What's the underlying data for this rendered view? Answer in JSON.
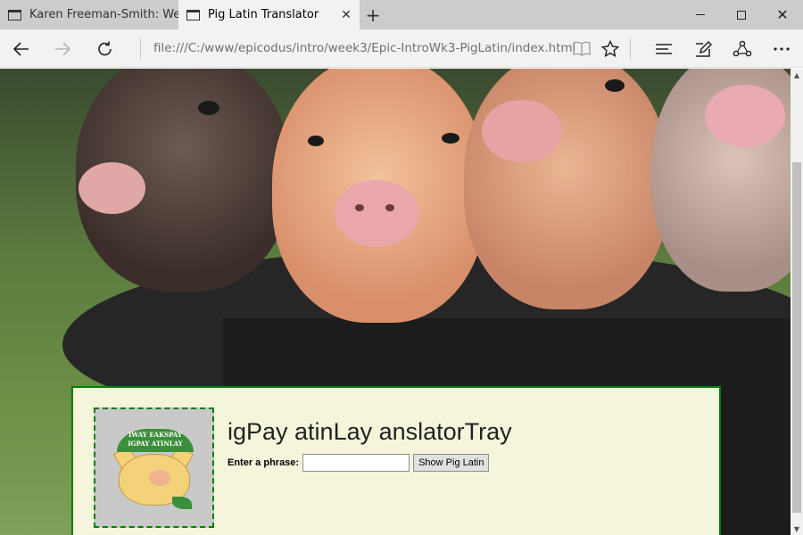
{
  "browser": {
    "tabs": [
      {
        "title": "Karen Freeman-Smith: Web",
        "active": false
      },
      {
        "title": "Pig Latin Translator",
        "active": true
      }
    ],
    "new_tab_glyph": "+",
    "url": "file:///C:/www/epicodus/intro/week3/Epic-IntroWk3-PigLatin/index.html",
    "icons": {
      "back": "back-arrow-icon",
      "forward": "forward-arrow-icon",
      "refresh": "refresh-icon",
      "reading_view": "reading-view-icon",
      "favorite": "star-icon",
      "hub": "hub-icon",
      "web_note": "web-note-icon",
      "share": "share-icon",
      "more": "more-icon"
    }
  },
  "page": {
    "hero_image": "Piglets in a black top hat",
    "logo": {
      "banner_line1": "IWAY EAKSPAY",
      "banner_line2": "IGPAY ATINLAY"
    },
    "title": "igPay atinLay anslatorTray",
    "form": {
      "label": "Enter a phrase:",
      "input_value": "",
      "input_placeholder": "",
      "button_label": "Show Pig Latin"
    }
  },
  "colors": {
    "panel_background": "#f5f5dc",
    "panel_border": "#008000"
  }
}
